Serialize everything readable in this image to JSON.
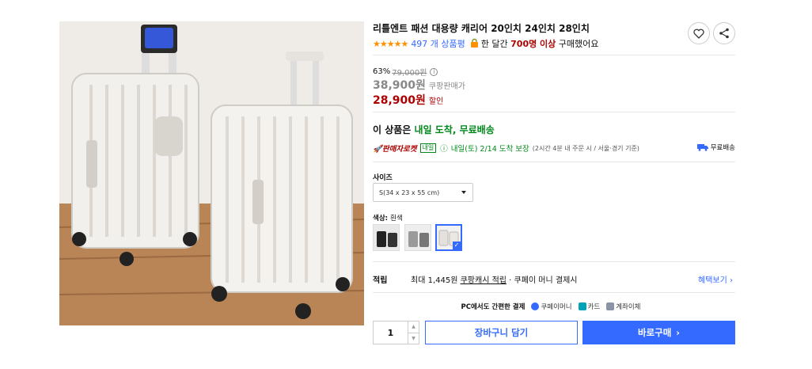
{
  "product": {
    "title": "리틀엔트 패션 대용량 캐리어 20인치 24인치 28인치",
    "stars": "★★★★★",
    "review_count": "497 개 상품평",
    "bought_prefix": "한 달간 ",
    "bought_count": "700명 이상",
    "bought_suffix": " 구매했어요"
  },
  "actions": {
    "wishlist_icon": "heart-icon",
    "share_icon": "share-icon"
  },
  "price": {
    "discount_rate": "63%",
    "original": "79,000원",
    "info_glyph": "i",
    "sale": "38,900원",
    "sale_label": "쿠팡판매가",
    "final": "28,900원",
    "final_label": "할인"
  },
  "delivery": {
    "headline_prefix": "이 상품은 ",
    "headline_green": "내일 도착, 무료배송",
    "rocket_logo": "🚀판매자로켓",
    "tag": "내일",
    "info_glyph": "ⓘ",
    "date": "내일(토) 2/14 도착 보장",
    "note": "(2시간 4분 내 주문 시 / 서울·경기 기준)",
    "free_shipping": "무료배송"
  },
  "options": {
    "size_label": "사이즈",
    "size_value": "S(34 x 23 x 55 cm)",
    "color_label": "색상: ",
    "color_value": "흰색"
  },
  "points": {
    "label": "적립",
    "text_prefix": "최대 1,445원 ",
    "text_link": "쿠팡캐시 적립",
    "text_suffix": " · 쿠페이 머니 결제시",
    "benefit_link": "혜택보기 ›"
  },
  "payment": {
    "title": "PC에서도 간편한 결제",
    "methods": [
      "쿠페이머니",
      "카드",
      "계좌이체"
    ],
    "colors": [
      "#346aff",
      "#00a2b8",
      "#8a94a6"
    ]
  },
  "purchase": {
    "quantity": "1",
    "up": "▲",
    "down": "▼",
    "cart_label": "장바구니 담기",
    "buy_label": "바로구매",
    "buy_chevron": "›"
  },
  "colors": {
    "accent": "#346aff",
    "price_red": "#ae0000",
    "delivery_green": "#00891a",
    "star": "#ff9000"
  }
}
